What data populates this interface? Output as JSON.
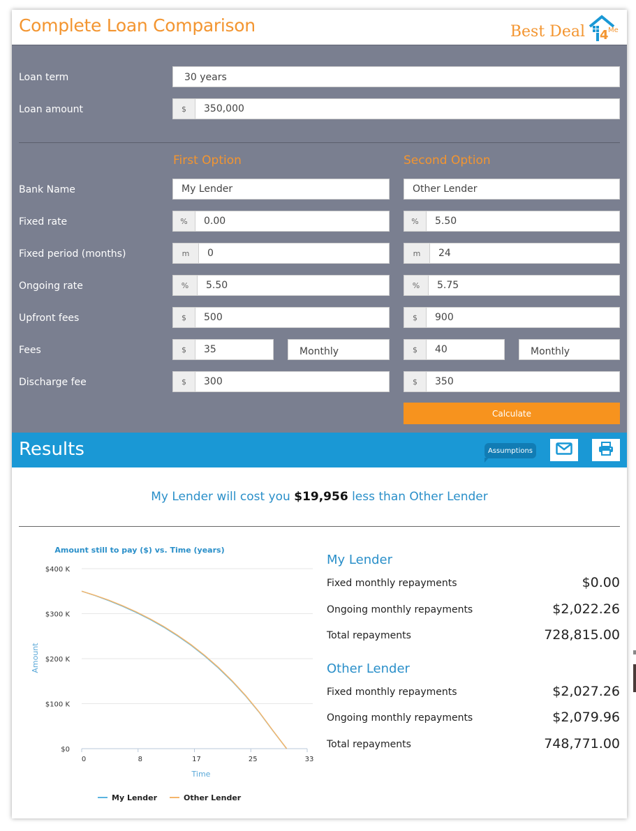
{
  "header": {
    "title": "Complete Loan Comparison",
    "logo_text": "Best Deal",
    "logo_suffix": "4Me"
  },
  "colors": {
    "accent_orange": "#f39530",
    "calculate_orange": "#f7931e",
    "results_blue": "#1a98d5",
    "form_bg": "#7a7f90",
    "series_my_lender": "#5ab4e0",
    "series_other_lender": "#f5b66b"
  },
  "loan": {
    "term_label": "Loan term",
    "term_value": "30 years",
    "amount_label": "Loan amount",
    "amount_addon": "$",
    "amount_value": "350,000"
  },
  "options": {
    "first_heading": "First Option",
    "second_heading": "Second Option",
    "labels": {
      "bank_name": "Bank Name",
      "fixed_rate": "Fixed rate",
      "fixed_period": "Fixed period (months)",
      "ongoing_rate": "Ongoing rate",
      "upfront_fees": "Upfront fees",
      "fees": "Fees",
      "discharge_fee": "Discharge fee"
    },
    "addons": {
      "percent": "%",
      "months": "m",
      "dollar": "$"
    },
    "first": {
      "bank_name": "My Lender",
      "fixed_rate": "0.00",
      "fixed_period": "0",
      "ongoing_rate": "5.50",
      "upfront_fees": "500",
      "fees": "35",
      "fees_frequency": "Monthly",
      "discharge_fee": "300"
    },
    "second": {
      "bank_name": "Other Lender",
      "fixed_rate": "5.50",
      "fixed_period": "24",
      "ongoing_rate": "5.75",
      "upfront_fees": "900",
      "fees": "40",
      "fees_frequency": "Monthly",
      "discharge_fee": "350"
    },
    "calculate_label": "Calculate"
  },
  "results": {
    "title": "Results",
    "assumptions_label": "Assumptions",
    "email_icon": "envelope-icon",
    "print_icon": "printer-icon",
    "summary_prefix": "My Lender will cost you",
    "summary_amount": "$19,956",
    "summary_suffix": "less than Other Lender",
    "lenders": [
      {
        "name": "My Lender",
        "rows": [
          {
            "label": "Fixed monthly repayments",
            "value": "$0.00"
          },
          {
            "label": "Ongoing monthly repayments",
            "value": "$2,022.26"
          },
          {
            "label": "Total repayments",
            "value": "728,815.00"
          }
        ]
      },
      {
        "name": "Other Lender",
        "rows": [
          {
            "label": "Fixed monthly repayments",
            "value": "$2,027.26"
          },
          {
            "label": "Ongoing monthly repayments",
            "value": "$2,079.96"
          },
          {
            "label": "Total repayments",
            "value": "748,771.00"
          }
        ]
      }
    ]
  },
  "chart_data": {
    "type": "line",
    "title": "Amount still to pay ($) vs. Time (years)",
    "xlabel": "Time",
    "ylabel": "Amount",
    "xlim": [
      0,
      33
    ],
    "ylim": [
      0,
      400000
    ],
    "x_ticks": [
      "0",
      "8",
      "17",
      "25",
      "33"
    ],
    "x_tick_values": [
      0,
      8.25,
      16.5,
      24.75,
      33
    ],
    "y_ticks": [
      "$0",
      "$100 K",
      "$200 K",
      "$300 K",
      "$400 K"
    ],
    "y_tick_values": [
      0,
      100000,
      200000,
      300000,
      400000
    ],
    "grid": true,
    "legend": "bottom-center",
    "series": [
      {
        "name": "My Lender",
        "x": [
          0,
          2,
          4,
          6,
          8,
          10,
          12,
          14,
          16,
          18,
          20,
          22,
          24,
          26,
          28,
          30
        ],
        "values": [
          350000,
          340000,
          328900,
          316500,
          302700,
          287300,
          270100,
          251000,
          229700,
          205900,
          179400,
          149900,
          117000,
          80300,
          39400,
          0
        ]
      },
      {
        "name": "Other Lender",
        "x": [
          0,
          2,
          4,
          6,
          8,
          10,
          12,
          14,
          16,
          18,
          20,
          22,
          24,
          26,
          28,
          30
        ],
        "values": [
          350000,
          340500,
          329700,
          317500,
          303900,
          288600,
          271500,
          252400,
          231100,
          207300,
          180700,
          151100,
          118000,
          81000,
          39800,
          0
        ]
      }
    ]
  }
}
